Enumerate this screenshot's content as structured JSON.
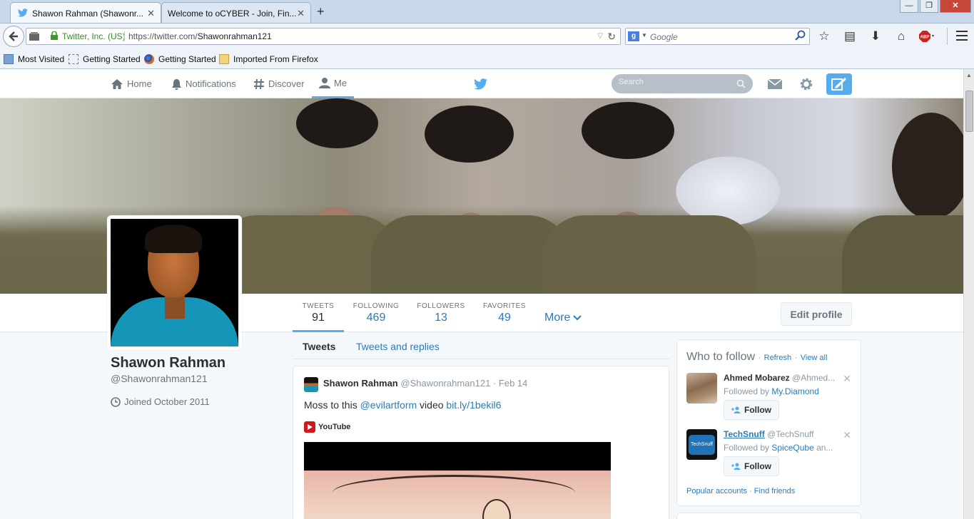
{
  "browser": {
    "tabs": [
      {
        "title": "Shawon Rahman (Shawonr...",
        "active": true
      },
      {
        "title": "Welcome to oCYBER - Join, Fin...",
        "active": false
      }
    ],
    "new_tab": "+",
    "identity": "Twitter, Inc. (US)",
    "url_prefix": "https://twitter.com/",
    "url_path": "Shawonrahman121",
    "search_placeholder": "Google",
    "window_buttons": {
      "minimize": "—",
      "restore": "❐",
      "close": "✕"
    },
    "bookmarks": [
      "Most Visited",
      "Getting Started",
      "Getting Started",
      "Imported From Firefox"
    ]
  },
  "twitter_nav": {
    "home": "Home",
    "notifications": "Notifications",
    "discover": "Discover",
    "me": "Me",
    "search_placeholder": "Search"
  },
  "profile": {
    "name": "Shawon Rahman",
    "handle": "@Shawonrahman121",
    "joined": "Joined October 2011",
    "stats": [
      {
        "label": "TWEETS",
        "value": "91"
      },
      {
        "label": "FOLLOWING",
        "value": "469"
      },
      {
        "label": "FOLLOWERS",
        "value": "13"
      },
      {
        "label": "FAVORITES",
        "value": "49"
      }
    ],
    "more": "More",
    "edit_profile": "Edit profile"
  },
  "timeline": {
    "tabs": [
      "Tweets",
      "Tweets and replies"
    ],
    "tweet": {
      "name": "Shawon Rahman",
      "handle": "@Shawonrahman121",
      "separator": "·",
      "date": "Feb 14",
      "text_prefix": "Moss to this ",
      "mention": "@evilartform",
      "text_middle": " video ",
      "link": "bit.ly/1bekil6",
      "media_source": "YouTube"
    }
  },
  "who_to_follow": {
    "title": "Who to follow",
    "dot": "·",
    "refresh": "Refresh",
    "view_all": "View all",
    "followed_by_prefix": "Followed by ",
    "users": [
      {
        "name": "Ahmed Mobarez",
        "handle": "@Ahmed...",
        "followed_by": "My.Diamond",
        "followed_by_suffix": "",
        "follow_label": "Follow"
      },
      {
        "name": "TechSnuff",
        "handle": "@TechSnuff",
        "followed_by": "SpiceQube",
        "followed_by_suffix": " an...",
        "follow_label": "Follow",
        "avatar_text": "TechSnuff"
      }
    ],
    "popular_accounts": "Popular accounts",
    "find_friends": "Find friends"
  },
  "colors": {
    "twitter_blue": "#55acee",
    "link_blue": "#2b7bb9",
    "text_dark": "#292f33",
    "text_gray": "#66757f"
  }
}
